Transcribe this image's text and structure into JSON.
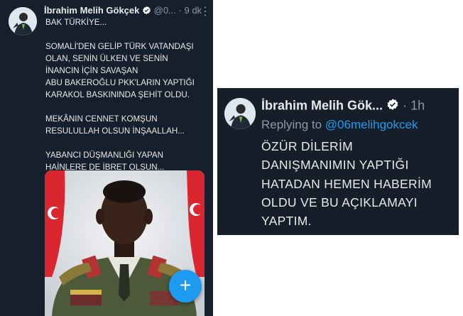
{
  "left_tweet": {
    "author_name": "İbrahim Melih Gökçek",
    "handle_truncated": "@0...",
    "separator": "·",
    "time": "9 dk",
    "more_glyph": "⋮",
    "lines": [
      "BAK TÜRKİYE...",
      "SOMALİ'DEN GELİP TÜRK VATANDAŞI",
      "OLAN, SENİN ÜLKEN VE SENİN",
      "İNANCIN İÇİN SAVAŞAN",
      "ABU BAKEROĞLU PKK'LARIN YAPTIĞI",
      "KARAKOL BASKININDA ŞEHİT OLDU.",
      "MEKÂNIN CENNET KOMŞUN",
      "RESULULLAH OLSUN İNŞAALLAH...",
      "YABANCI DÜŞMANLIĞI YAPAN",
      "HAİNLERE DE İBRET OLSUN..."
    ],
    "fab_glyph": "+"
  },
  "right_reply": {
    "author_name": "İbrahim Melih Gök...",
    "separator": "·",
    "time": "1h",
    "replying_prefix": "Replying to",
    "replying_handle": "@06melihgokcek",
    "lines": [
      "ÖZÜR DİLERİM",
      "DANIŞMANIMIN YAPTIĞI",
      "HATADAN HEMEN HABERİM",
      "OLDU VE BU AÇIKLAMAYI",
      "YAPTIM."
    ]
  },
  "colors": {
    "background": "#15202b",
    "text": "#e7e9ea",
    "muted": "#8b98a5",
    "link": "#1d9bf0",
    "verified_badge": "#ffffff"
  },
  "icons": {
    "verified": "verified-badge-icon",
    "more": "more-vertical-icon",
    "compose": "plus-icon",
    "flag": "turkish-flag-icon"
  }
}
